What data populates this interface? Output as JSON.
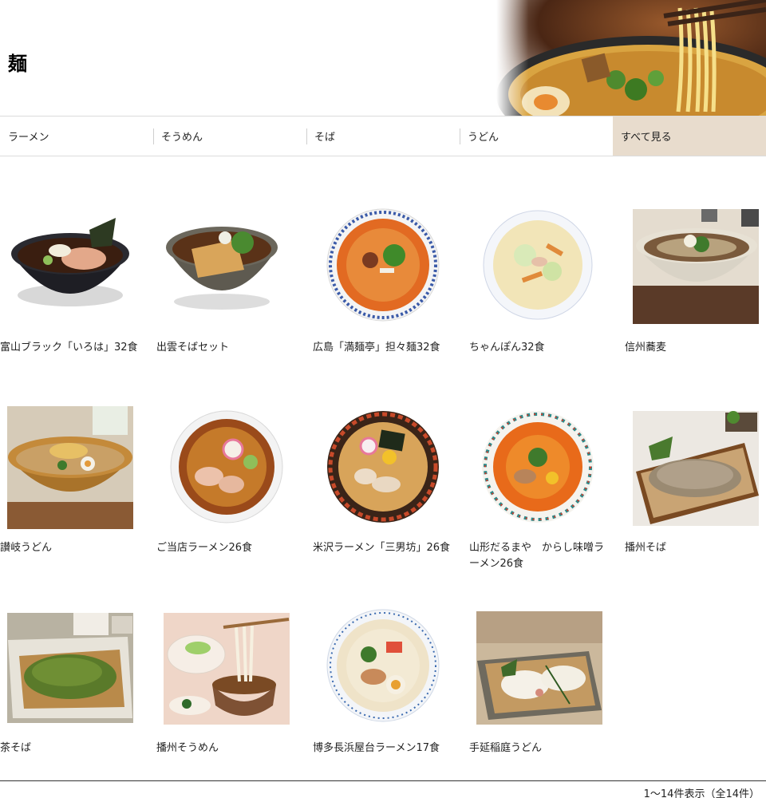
{
  "page": {
    "title": "麺"
  },
  "tabs": [
    {
      "label": "ラーメン"
    },
    {
      "label": "そうめん"
    },
    {
      "label": "そば"
    },
    {
      "label": "うどん"
    },
    {
      "label": "すべて見る",
      "active": true
    }
  ],
  "products": [
    {
      "name": "富山ブラック「いろは」32食",
      "image": "black-ramen-bowl"
    },
    {
      "name": "出雲そばセット",
      "image": "soba-bowl"
    },
    {
      "name": "広島「満麺亭」担々麺32食",
      "image": "tantanmen-plate"
    },
    {
      "name": "ちゃんぽん32食",
      "image": "champon-plate"
    },
    {
      "name": "信州蕎麦",
      "image": "soba-photo"
    },
    {
      "name": "讃岐うどん",
      "image": "udon-photo"
    },
    {
      "name": "ご当店ラーメン26食",
      "image": "shoyu-ramen-plate"
    },
    {
      "name": "米沢ラーメン「三男坊」26食",
      "image": "miso-ramen-plate"
    },
    {
      "name": "山形だるまや　からし味噌ラーメン26食",
      "image": "karashi-miso-plate"
    },
    {
      "name": "播州そば",
      "image": "zaru-soba-photo"
    },
    {
      "name": "茶そば",
      "image": "cha-soba-photo"
    },
    {
      "name": "播州そうめん",
      "image": "somen-photo"
    },
    {
      "name": "博多長浜屋台ラーメン17食",
      "image": "tonkotsu-plate"
    },
    {
      "name": "手延稲庭うどん",
      "image": "inaniwa-photo"
    }
  ],
  "footer": {
    "count_text": "1～14件表示（全14件）"
  },
  "colors": {
    "active_tab_bg": "#e8dccd",
    "divider": "#333333"
  }
}
